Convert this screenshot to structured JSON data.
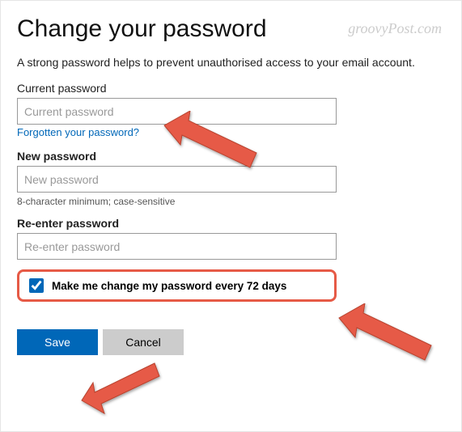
{
  "watermark": "groovyPost.com",
  "heading": "Change your password",
  "subtitle": "A strong password helps to prevent unauthorised access to your email account.",
  "current": {
    "label": "Current password",
    "placeholder": "Current password",
    "value": ""
  },
  "forgot": "Forgotten your password?",
  "newpw": {
    "label": "New password",
    "placeholder": "New password",
    "value": ""
  },
  "help": "8-character minimum; case-sensitive",
  "reenter": {
    "label": "Re-enter password",
    "placeholder": "Re-enter password",
    "value": ""
  },
  "expire": {
    "checked": true,
    "label": "Make me change my password every 72 days"
  },
  "buttons": {
    "save": "Save",
    "cancel": "Cancel"
  }
}
